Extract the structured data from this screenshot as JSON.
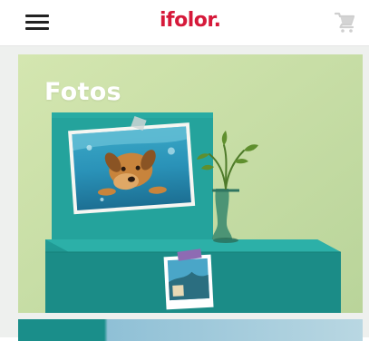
{
  "header": {
    "logo": "ifolor.",
    "menu_icon": "hamburger-menu-icon",
    "cart_icon": "shopping-cart-icon"
  },
  "hero": {
    "title": "Fotos"
  },
  "colors": {
    "brand": "#d6193a",
    "teal": "#1f9c97",
    "background": "#c7dea4"
  }
}
